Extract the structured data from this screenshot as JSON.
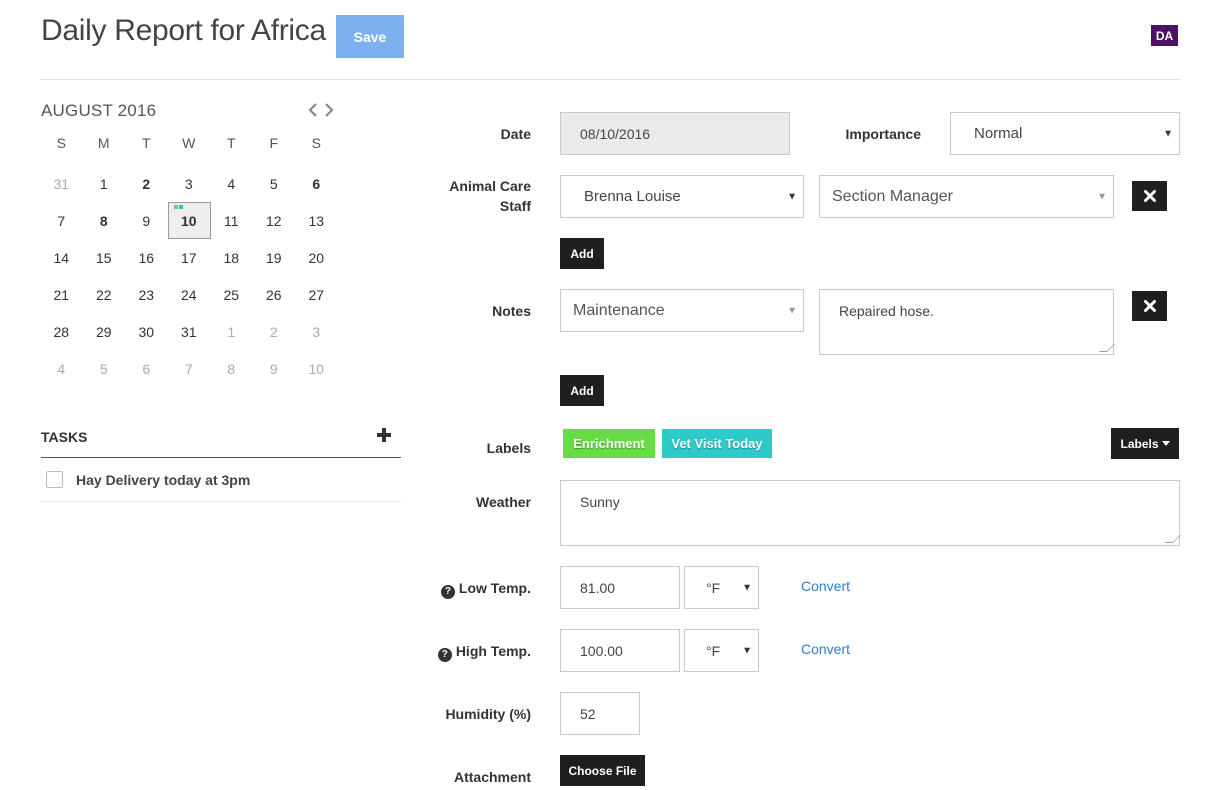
{
  "header": {
    "title": "Daily Report for Africa",
    "save_label": "Save",
    "avatar_initials": "DA",
    "avatar_color": "#4a1265",
    "save_color": "#7cb0ee"
  },
  "calendar": {
    "month_label": "AUGUST 2016",
    "weekdays": [
      "S",
      "M",
      "T",
      "W",
      "T",
      "F",
      "S"
    ],
    "weeks": [
      [
        {
          "d": "31",
          "other": true
        },
        {
          "d": "1"
        },
        {
          "d": "2",
          "bold": true
        },
        {
          "d": "3"
        },
        {
          "d": "4"
        },
        {
          "d": "5"
        },
        {
          "d": "6",
          "bold": true
        }
      ],
      [
        {
          "d": "7"
        },
        {
          "d": "8",
          "bold": true
        },
        {
          "d": "9"
        },
        {
          "d": "10",
          "selected": true
        },
        {
          "d": "11"
        },
        {
          "d": "12"
        },
        {
          "d": "13"
        }
      ],
      [
        {
          "d": "14"
        },
        {
          "d": "15"
        },
        {
          "d": "16"
        },
        {
          "d": "17"
        },
        {
          "d": "18"
        },
        {
          "d": "19"
        },
        {
          "d": "20"
        }
      ],
      [
        {
          "d": "21"
        },
        {
          "d": "22"
        },
        {
          "d": "23"
        },
        {
          "d": "24"
        },
        {
          "d": "25"
        },
        {
          "d": "26"
        },
        {
          "d": "27"
        }
      ],
      [
        {
          "d": "28"
        },
        {
          "d": "29"
        },
        {
          "d": "30"
        },
        {
          "d": "31"
        },
        {
          "d": "1",
          "other": true
        },
        {
          "d": "2",
          "other": true
        },
        {
          "d": "3",
          "other": true
        }
      ],
      [
        {
          "d": "4",
          "other": true
        },
        {
          "d": "5",
          "other": true
        },
        {
          "d": "6",
          "other": true
        },
        {
          "d": "7",
          "other": true
        },
        {
          "d": "8",
          "other": true
        },
        {
          "d": "9",
          "other": true
        },
        {
          "d": "10",
          "other": true
        }
      ]
    ],
    "selected_dot_colors": [
      "#5cd65c",
      "#2bc4c4"
    ]
  },
  "tasks": {
    "title": "TASKS",
    "add_icon": "plus-icon",
    "items": [
      {
        "label": "Hay Delivery today at 3pm",
        "checked": false
      }
    ]
  },
  "form": {
    "date": {
      "label": "Date",
      "value": "08/10/2016"
    },
    "importance": {
      "label": "Importance",
      "value": "Normal"
    },
    "animal_care_staff": {
      "label_line1": "Animal Care",
      "label_line2": "Staff",
      "staff_value": "Brenna Louise",
      "role_value": "Section Manager",
      "add_label": "Add"
    },
    "notes": {
      "label": "Notes",
      "category_value": "Maintenance",
      "text_value": "Repaired hose.",
      "add_label": "Add"
    },
    "labels": {
      "label": "Labels",
      "tags": [
        {
          "text": "Enrichment",
          "color": "#66dd44"
        },
        {
          "text": "Vet Visit Today",
          "color": "#2ecaca"
        }
      ],
      "dropdown_label": "Labels"
    },
    "weather": {
      "label": "Weather",
      "value": "Sunny"
    },
    "low_temp": {
      "label": "Low Temp.",
      "value": "81.00",
      "unit": "°F",
      "convert_label": "Convert"
    },
    "high_temp": {
      "label": "High Temp.",
      "value": "100.00",
      "unit": "°F",
      "convert_label": "Convert"
    },
    "humidity": {
      "label": "Humidity (%)",
      "value": "52"
    },
    "attachment": {
      "label": "Attachment",
      "button_label": "Choose File"
    }
  }
}
